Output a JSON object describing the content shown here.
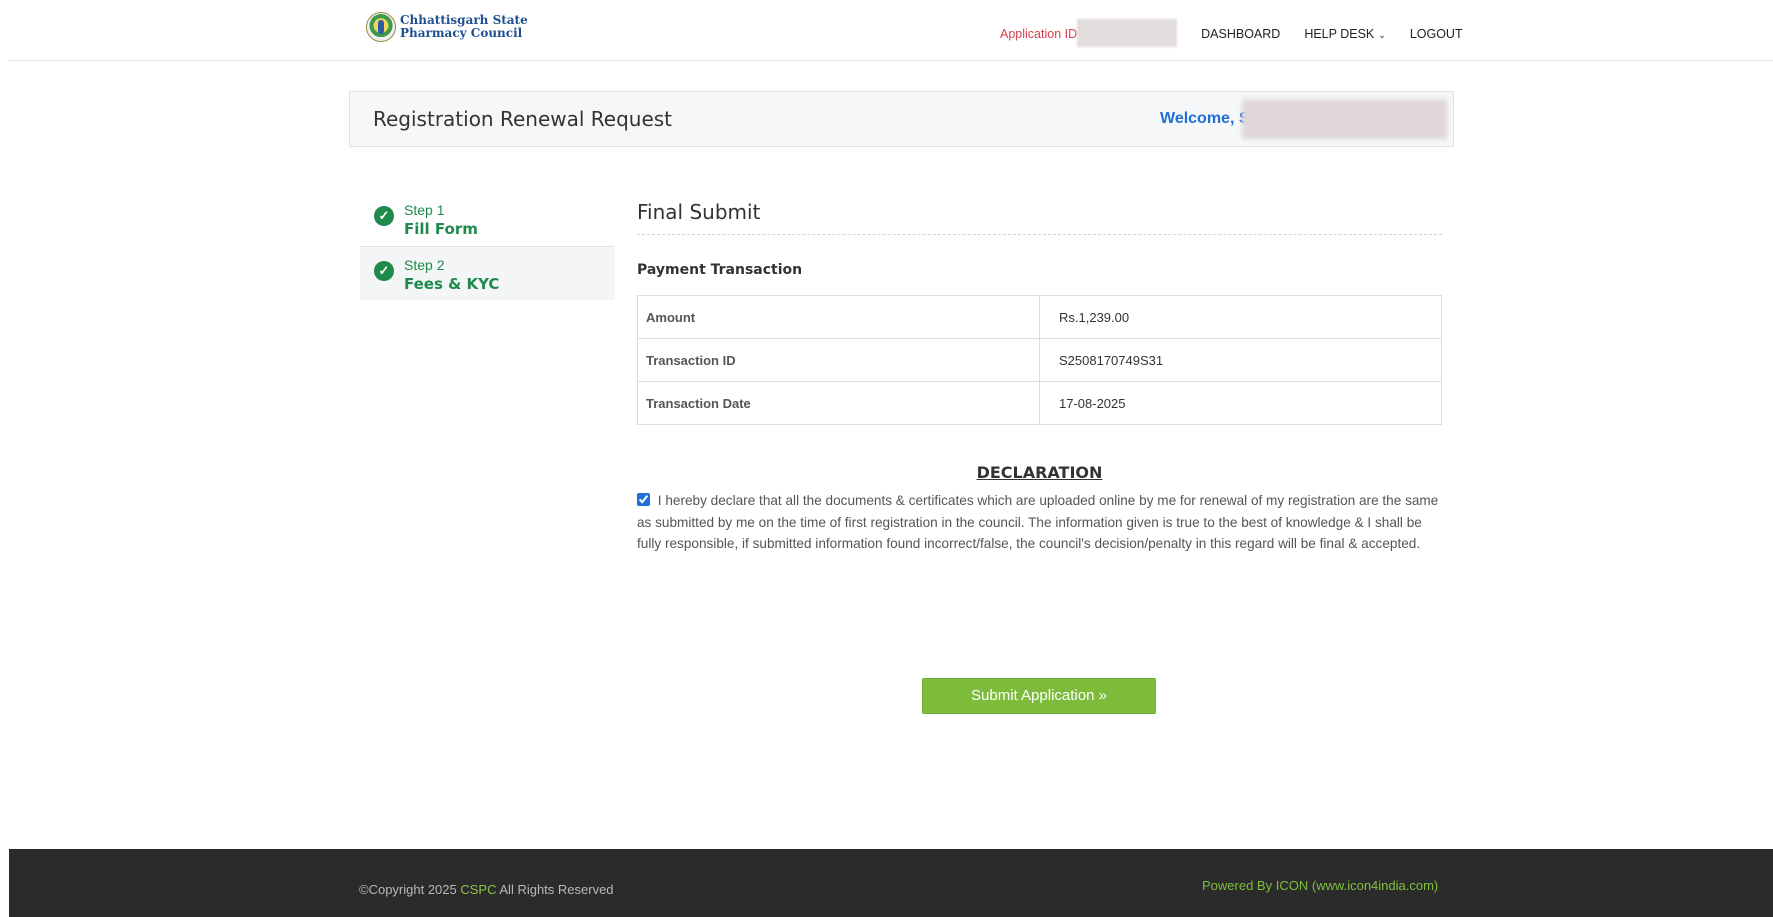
{
  "header": {
    "logo_line1": "Chhattisgarh State",
    "logo_line2": "Pharmacy Council",
    "application_id_label": "Application ID",
    "nav": {
      "dashboard": "DASHBOARD",
      "helpdesk": "HELP DESK",
      "logout": "LOGOUT"
    }
  },
  "titlebar": {
    "title": "Registration Renewal Request",
    "welcome": "Welcome, S"
  },
  "steps": [
    {
      "number": "Step 1",
      "name": "Fill Form"
    },
    {
      "number": "Step 2",
      "name": "Fees & KYC"
    }
  ],
  "main": {
    "section_title": "Final Submit",
    "sub_title": "Payment Transaction",
    "transaction": {
      "amount_label": "Amount",
      "amount_value": "Rs.1,239.00",
      "id_label": "Transaction ID",
      "id_value": "S2508170749S31",
      "date_label": "Transaction Date",
      "date_value": "17-08-2025"
    },
    "declaration_title": "DECLARATION",
    "declaration_text": "I hereby declare that all the documents & certificates which are uploaded online by me for renewal of my registration are the same as submitted by me on the time of first registration in the council. The information given is true to the best of knowledge & I shall be fully responsible, if submitted information found incorrect/false, the council's decision/penalty in this regard will be final & accepted.",
    "declaration_checked": true,
    "submit_label": "Submit Application »"
  },
  "footer": {
    "copyright_prefix": "©Copyright 2025 ",
    "copyright_brand": "CSPC",
    "copyright_suffix": " All Rights Reserved",
    "powered_by": "Powered By ICON (www.icon4india.com)"
  },
  "colors": {
    "accent_green": "#7cbc3a",
    "step_green": "#1f8a4c",
    "link_blue": "#1f6fd6",
    "app_id_red": "#d43f4b",
    "footer_bg": "#2b2b2b"
  }
}
